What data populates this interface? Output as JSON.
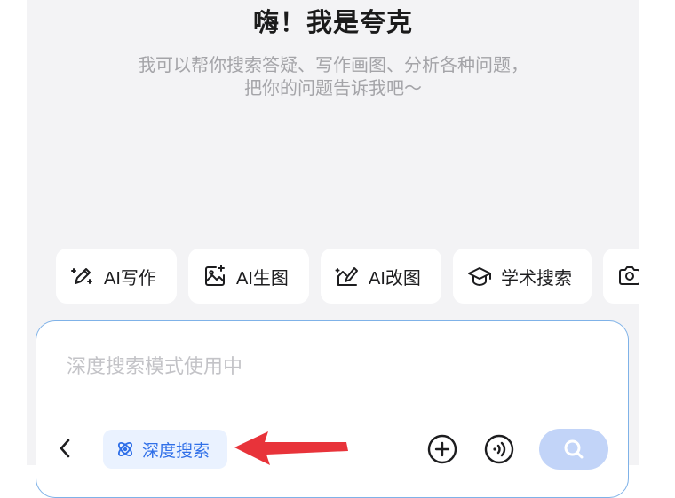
{
  "header": {
    "title": "嗨！我是夸克",
    "subtitle_line1": "我可以帮你搜索答疑、写作画图、分析各种问题，",
    "subtitle_line2": "把你的问题告诉我吧～"
  },
  "chips": [
    {
      "label": "AI写作",
      "icon": "pen-sparkle-icon"
    },
    {
      "label": "AI生图",
      "icon": "image-sparkle-icon"
    },
    {
      "label": "AI改图",
      "icon": "edit-image-icon"
    },
    {
      "label": "学术搜索",
      "icon": "graduation-cap-icon"
    },
    {
      "label": "",
      "icon": "camera-icon"
    }
  ],
  "input": {
    "placeholder": "深度搜索模式使用中"
  },
  "toolbar": {
    "back_icon": "chevron-left-icon",
    "deep_search_label": "深度搜索",
    "deep_search_icon": "deep-search-icon",
    "add_icon": "plus-circle-icon",
    "voice_icon": "voice-wave-icon",
    "send_icon": "search-icon"
  },
  "colors": {
    "accent": "#2f6fe8",
    "accent_light": "#eaf2ff",
    "send_disabled": "#c2d4f8",
    "input_border": "#7fb2e8",
    "annotation_arrow": "#e8333a"
  }
}
